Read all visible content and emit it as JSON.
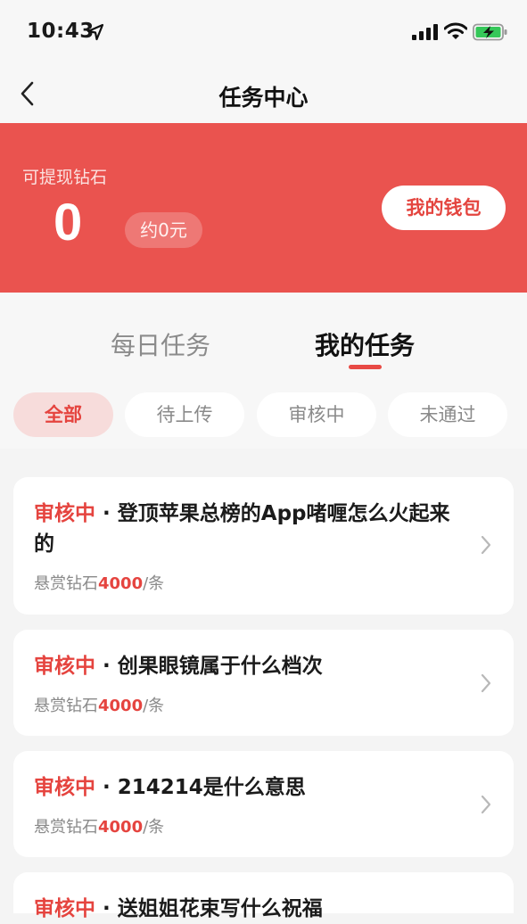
{
  "status_bar": {
    "time": "10:43",
    "icons": [
      "location-arrow-icon",
      "cellular-signal-icon",
      "wifi-icon",
      "battery-charging-icon"
    ]
  },
  "nav": {
    "title": "任务中心",
    "back_icon": "chevron-left-icon"
  },
  "wallet": {
    "label": "可提现钻石",
    "amount": "0",
    "rmb_value": "约0元",
    "wallet_button": "我的钱包",
    "banner_color": "#ea534f"
  },
  "tabs": [
    {
      "label": "每日任务",
      "active": false
    },
    {
      "label": "我的任务",
      "active": true
    }
  ],
  "filters": [
    {
      "label": "全部",
      "active": true
    },
    {
      "label": "待上传",
      "active": false
    },
    {
      "label": "审核中",
      "active": false
    },
    {
      "label": "未通过",
      "active": false
    }
  ],
  "tasks": [
    {
      "status": "审核中",
      "title": "登顶苹果总榜的App啫喱怎么火起来的",
      "reward_label": "悬赏钻石",
      "reward_value": "4000",
      "reward_unit": "/条"
    },
    {
      "status": "审核中",
      "title": "创果眼镜属于什么档次",
      "reward_label": "悬赏钻石",
      "reward_value": "4000",
      "reward_unit": "/条"
    },
    {
      "status": "审核中",
      "title": "214214是什么意思",
      "reward_label": "悬赏钻石",
      "reward_value": "4000",
      "reward_unit": "/条"
    },
    {
      "status": "审核中",
      "title": "送姐姐花束写什么祝福"
    }
  ],
  "colors": {
    "accent": "#e5443f",
    "background": "#f4f4f4"
  }
}
